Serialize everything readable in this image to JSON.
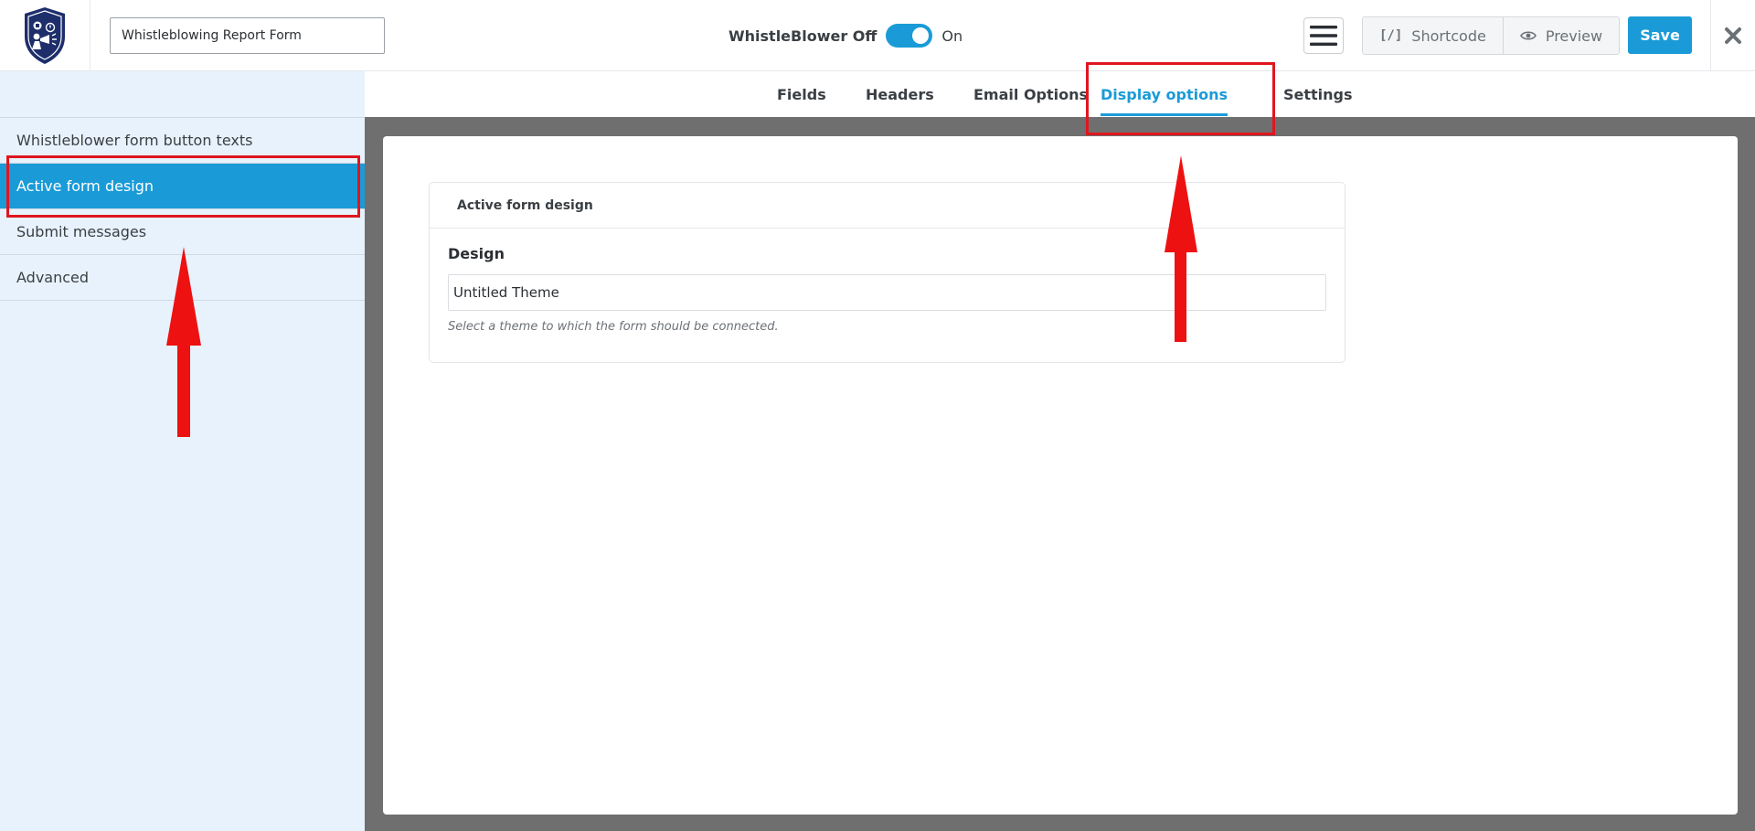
{
  "header": {
    "form_title": "Whistleblowing Report Form",
    "toggle_off_label": "WhistleBlower Off",
    "toggle_on_label": "On",
    "toggle_state": "on",
    "shortcode_label": "Shortcode",
    "shortcode_glyph": "[/]",
    "preview_label": "Preview",
    "save_label": "Save",
    "close_glyph": "✖"
  },
  "tabs": [
    {
      "label": "Fields",
      "active": false
    },
    {
      "label": "Headers",
      "active": false
    },
    {
      "label": "Email Options",
      "active": false
    },
    {
      "label": "Display options",
      "active": true
    },
    {
      "label": "Settings",
      "active": false
    }
  ],
  "sidebar": {
    "items": [
      {
        "label": "Whistleblower form button texts",
        "active": false
      },
      {
        "label": "Active form design",
        "active": true
      },
      {
        "label": "Submit messages",
        "active": false
      },
      {
        "label": "Advanced",
        "active": false
      }
    ]
  },
  "panel": {
    "title": "Active form design",
    "field_label": "Design",
    "selected_value": "Untitled Theme",
    "help_text": "Select a theme to which the form should be connected."
  },
  "icons": {
    "logo": "shield-whistleblower-logo-icon",
    "menu": "hamburger-menu-icon",
    "preview": "eye-icon",
    "close": "close-icon"
  },
  "colors": {
    "accent": "#1a9bd7",
    "sidebar_bg": "#e8f2fc",
    "main_bg": "#6f6f6f",
    "annotation": "#e0161e",
    "logo_navy": "#1d2e6b"
  }
}
